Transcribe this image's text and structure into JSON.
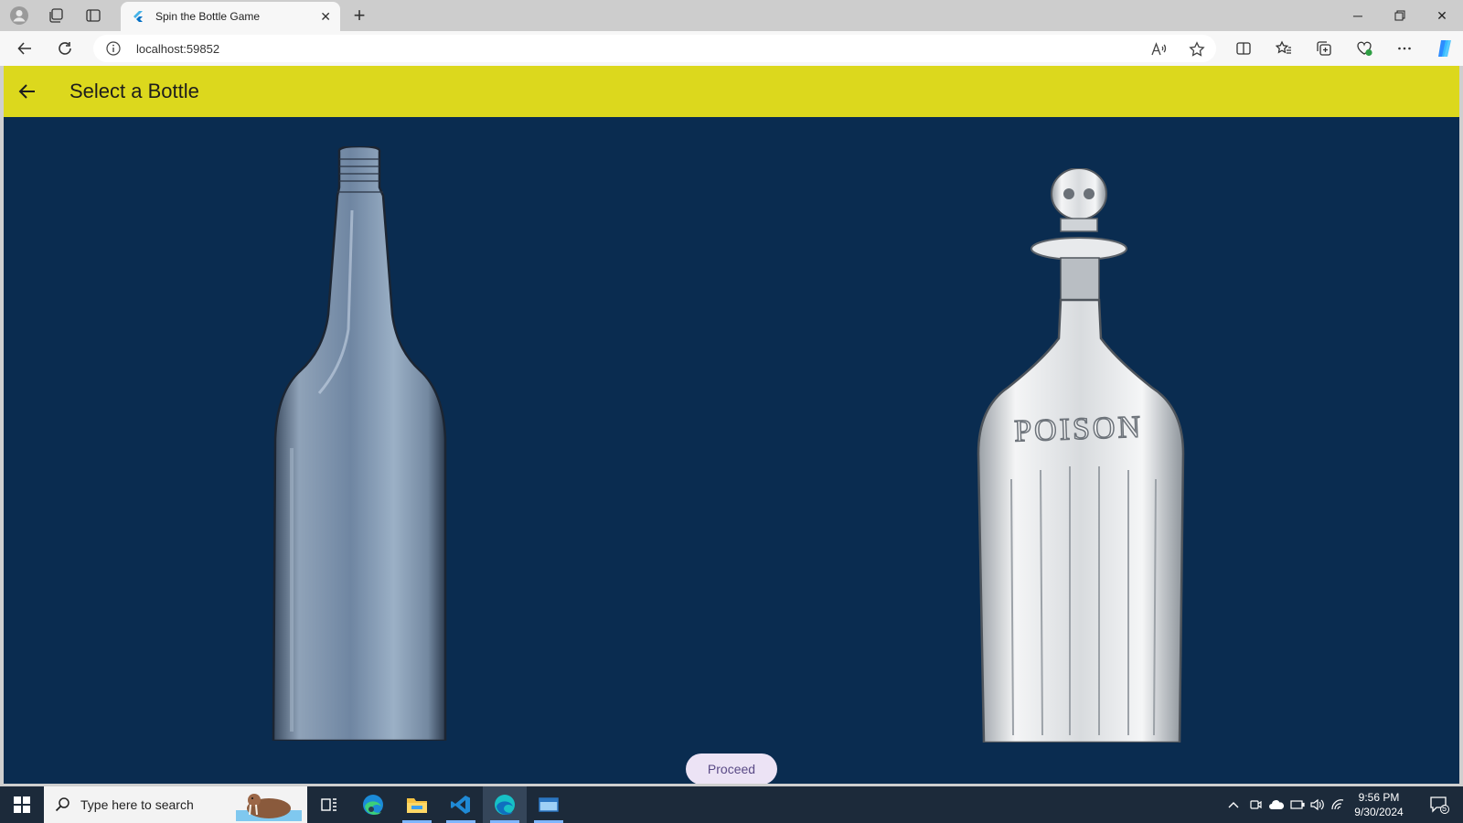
{
  "browser": {
    "tab_title": "Spin the Bottle Game",
    "url": "localhost:59852"
  },
  "app": {
    "title": "Select a Bottle",
    "proceed_label": "Proceed",
    "bottles": [
      {
        "name": "clear-glass-bottle"
      },
      {
        "name": "poison-bottle",
        "embossed_text": "POISON"
      }
    ],
    "colors": {
      "appbar": "#dcd81d",
      "background": "#0a2c50",
      "proceed_bg": "#ece3f5"
    }
  },
  "taskbar": {
    "search_placeholder": "Type here to search",
    "time": "9:56 PM",
    "date": "9/30/2024",
    "notification_count": "5"
  }
}
